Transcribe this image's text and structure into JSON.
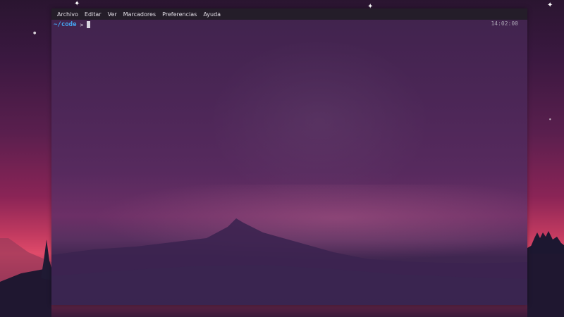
{
  "menubar": {
    "items": [
      {
        "label": "Archivo"
      },
      {
        "label": "Editar"
      },
      {
        "label": "Ver"
      },
      {
        "label": "Marcadores"
      },
      {
        "label": "Preferencias"
      },
      {
        "label": "Ayuda"
      }
    ]
  },
  "terminal": {
    "prompt_path": "~/code",
    "prompt_symbol": ">",
    "clock": "14:02:00"
  },
  "colors": {
    "prompt_path": "#45a6f2",
    "menubar_bg": "#241d29",
    "terminal_bg": "#4b2656"
  }
}
